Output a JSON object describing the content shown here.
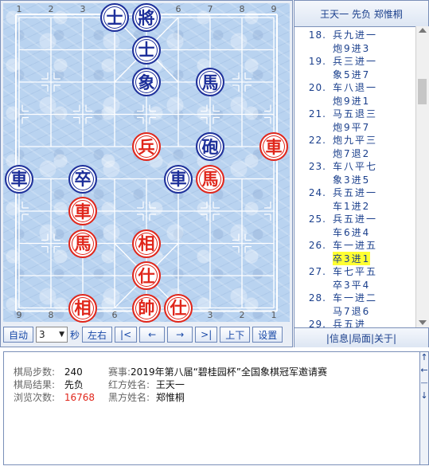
{
  "board": {
    "top_files": [
      "1",
      "2",
      "3",
      "4",
      "5",
      "6",
      "7",
      "8",
      "9"
    ],
    "bottom_files": [
      "9",
      "8",
      "7",
      "6",
      "5",
      "4",
      "3",
      "2",
      "1"
    ],
    "pieces": [
      {
        "char": "士",
        "side": "black",
        "file": 4,
        "rank": 0
      },
      {
        "char": "將",
        "side": "black",
        "file": 5,
        "rank": 0
      },
      {
        "char": "士",
        "side": "black",
        "file": 5,
        "rank": 1
      },
      {
        "char": "象",
        "side": "black",
        "file": 5,
        "rank": 2
      },
      {
        "char": "馬",
        "side": "black",
        "file": 7,
        "rank": 2
      },
      {
        "char": "兵",
        "side": "red",
        "file": 5,
        "rank": 4
      },
      {
        "char": "砲",
        "side": "black",
        "file": 7,
        "rank": 4
      },
      {
        "char": "車",
        "side": "red",
        "file": 9,
        "rank": 4
      },
      {
        "char": "車",
        "side": "black",
        "file": 1,
        "rank": 5
      },
      {
        "char": "卒",
        "side": "black",
        "file": 3,
        "rank": 5
      },
      {
        "char": "車",
        "side": "black",
        "file": 6,
        "rank": 5
      },
      {
        "char": "馬",
        "side": "red",
        "file": 7,
        "rank": 5
      },
      {
        "char": "車",
        "side": "red",
        "file": 3,
        "rank": 6
      },
      {
        "char": "馬",
        "side": "red",
        "file": 3,
        "rank": 7
      },
      {
        "char": "相",
        "side": "red",
        "file": 5,
        "rank": 7
      },
      {
        "char": "仕",
        "side": "red",
        "file": 5,
        "rank": 8
      },
      {
        "char": "相",
        "side": "red",
        "file": 3,
        "rank": 9
      },
      {
        "char": "帥",
        "side": "red",
        "file": 5,
        "rank": 9
      },
      {
        "char": "仕",
        "side": "red",
        "file": 6,
        "rank": 9
      }
    ]
  },
  "controls": {
    "auto": "自动",
    "speed_value": "3",
    "dropdown_arrow": "▼",
    "seconds": "秒",
    "left_right": "左右",
    "first": "|<",
    "prev": "←",
    "next": "→",
    "last": ">|",
    "up_down": "上下",
    "settings": "设置"
  },
  "panel": {
    "title": "王天一 先负 郑惟桐",
    "moves": [
      {
        "num": "18.",
        "red": "兵九进一",
        "black": "炮9进3"
      },
      {
        "num": "19.",
        "red": "兵三进一",
        "black": "象5进7"
      },
      {
        "num": "20.",
        "red": "车八退一",
        "black": "炮9进1"
      },
      {
        "num": "21.",
        "red": "马五退三",
        "black": "炮9平7"
      },
      {
        "num": "22.",
        "red": "炮九平三",
        "black": "炮7退2"
      },
      {
        "num": "23.",
        "red": "车八平七",
        "black": "象3进5"
      },
      {
        "num": "24.",
        "red": "兵五进一",
        "black": "车1进2"
      },
      {
        "num": "25.",
        "red": "兵五进一",
        "black": "车6进4"
      },
      {
        "num": "26.",
        "red": "车一进五",
        "black": "卒3进1"
      },
      {
        "num": "27.",
        "red": "车七平五",
        "black": "卒3平4"
      },
      {
        "num": "28.",
        "red": "车一进二",
        "black": "马7退6"
      },
      {
        "num": "29.",
        "red": "兵五进",
        "black": ""
      }
    ],
    "highlight": {
      "move_index": 8,
      "side": "black"
    },
    "links": "|信息|局面|关于|"
  },
  "info": {
    "steps_label": "棋局步数:",
    "steps_value": "240",
    "result_label": "棋局结果:",
    "result_value": "先负",
    "views_label": "浏览次数:",
    "views_value": "16768",
    "event_label": "赛事:",
    "event_value": "2019年第八届“碧桂园杯”全国象棋冠军邀请赛",
    "red_label": "红方姓名:",
    "red_value": "王天一",
    "black_label": "黑方姓名:",
    "black_value": "郑惟桐"
  },
  "scroll_arrows": {
    "up": "↑",
    "left": "←",
    "minus": "—",
    "down": "↓"
  },
  "colors": {
    "red_piece": "#e0261b",
    "black_piece": "#1d2f9a",
    "accent": "#1a3f8c",
    "highlight": "#ffff33",
    "views": "#e0261b"
  }
}
